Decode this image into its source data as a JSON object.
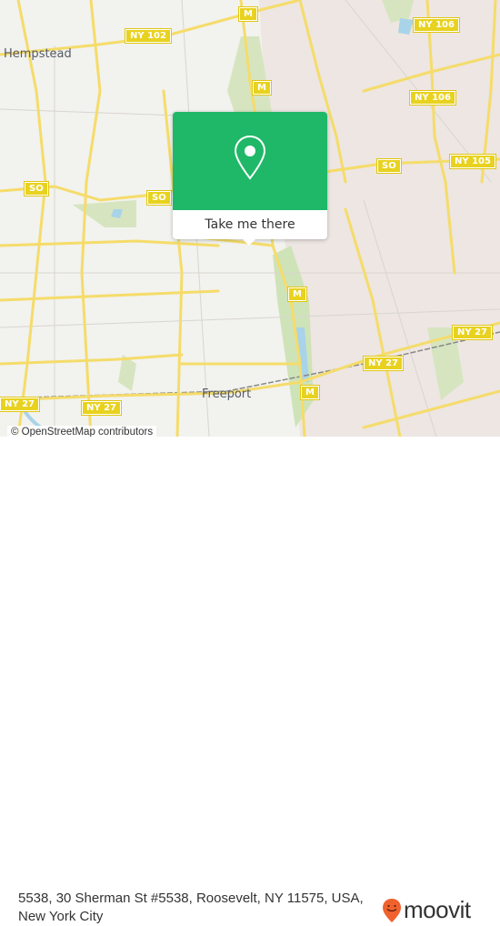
{
  "map": {
    "place_labels": [
      {
        "id": "hempstead",
        "text": "Hempstead"
      },
      {
        "id": "freeport",
        "text": "Freeport"
      }
    ],
    "route_shields": [
      {
        "id": "ny102",
        "text": "NY 102"
      },
      {
        "id": "ny106a",
        "text": "NY 106"
      },
      {
        "id": "ny106b",
        "text": "NY 106"
      },
      {
        "id": "ny105",
        "text": "NY 105"
      },
      {
        "id": "so1",
        "text": "SO"
      },
      {
        "id": "so2",
        "text": "SO"
      },
      {
        "id": "so3",
        "text": "SO"
      },
      {
        "id": "m1",
        "text": "M"
      },
      {
        "id": "m2",
        "text": "M"
      },
      {
        "id": "m3",
        "text": "M"
      },
      {
        "id": "m4",
        "text": "M"
      },
      {
        "id": "ny27a",
        "text": "NY 27"
      },
      {
        "id": "ny27b",
        "text": "NY 27"
      },
      {
        "id": "ny27c",
        "text": "NY 27"
      },
      {
        "id": "ny27d",
        "text": "NY 27"
      }
    ],
    "attribution": "© OpenStreetMap contributors"
  },
  "popup": {
    "icon": "map-pin-icon",
    "button_label": "Take me there",
    "color": "#1fb868"
  },
  "footer": {
    "address": "5538, 30 Sherman St #5538, Roosevelt, NY 11575, USA, New York City",
    "brand": "moovit",
    "brand_color": "#f0622d"
  }
}
